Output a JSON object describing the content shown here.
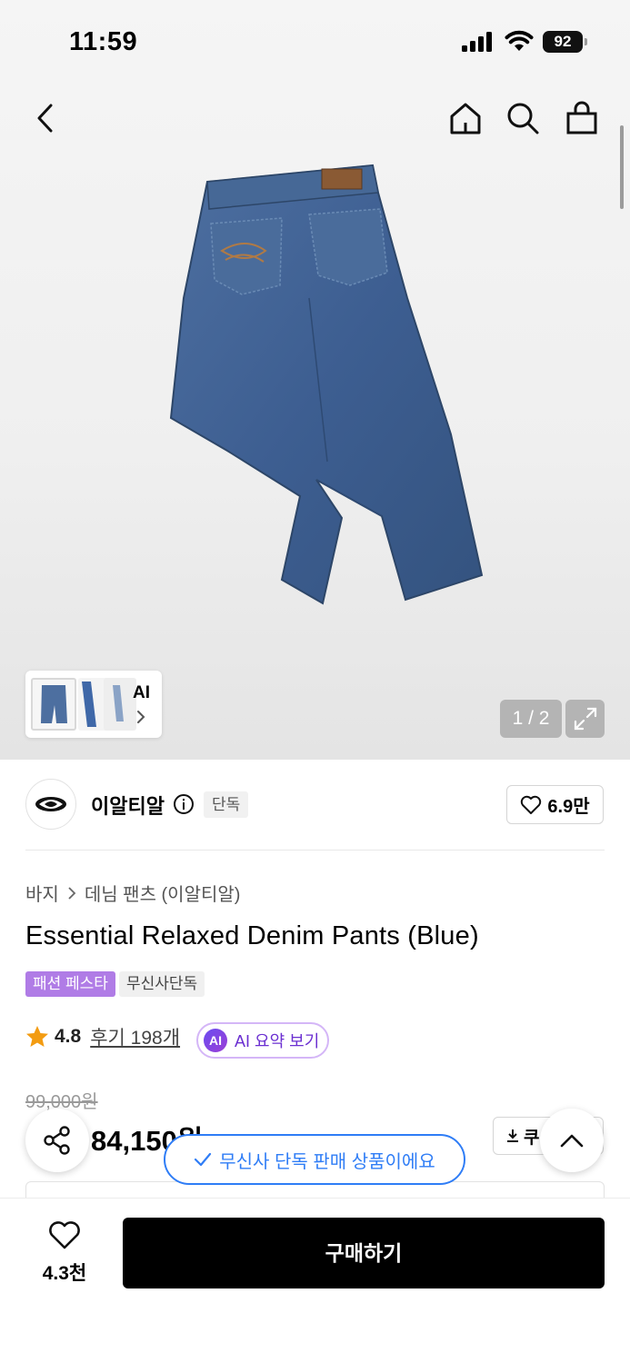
{
  "status_bar": {
    "time": "11:59",
    "battery": "92"
  },
  "gallery": {
    "counter": "1 / 2",
    "thumb_label": "AI"
  },
  "brand": {
    "name": "이알티알",
    "exclusive_tag": "단독",
    "likes": "6.9만"
  },
  "breadcrumb": {
    "category": "바지",
    "sub": "데님 팬츠 (이알티알)"
  },
  "product": {
    "title": "Essential Relaxed Denim Pants (Blue)",
    "badges": [
      "패션 페스타",
      "무신사단독"
    ],
    "rating": "4.8",
    "reviews": "후기 198개",
    "ai_summary": "AI 요약 보기",
    "ai_icon": "AI",
    "original_price": "99,000원",
    "sale_price": "84,150원",
    "coupon": "쿠"
  },
  "toast": {
    "text": "무신사 단독 판매 상품이에요"
  },
  "bottom": {
    "wish_count": "4.3천",
    "buy_label": "구매하기"
  },
  "colors": {
    "accent_blue": "#2f7df6",
    "fest_purple": "#b07ce6",
    "star": "#f39c12"
  }
}
